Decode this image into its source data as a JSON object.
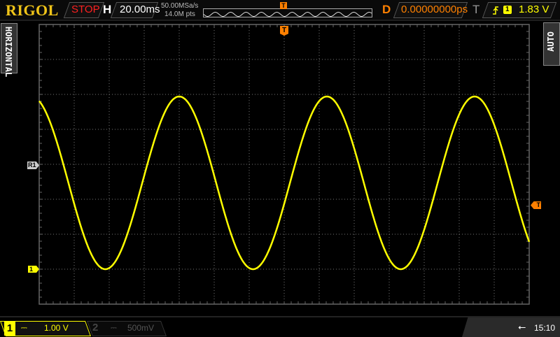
{
  "header": {
    "logo": "RIGOL",
    "run_state": "STOP",
    "horizontal_label": "H",
    "timebase": "20.00ms",
    "sample_rate": "50.00MSa/s",
    "memory_depth": "14.0M pts",
    "delay_label": "D",
    "delay_value": "0.00000000ps",
    "trigger_label": "T",
    "trigger_slope_icon": "rising-edge-icon",
    "trigger_source": "1",
    "trigger_level": "1.83 V"
  },
  "side_tabs": {
    "left": "HORIZONTAL",
    "right": "AUTO"
  },
  "markers": {
    "trigger_top": "T",
    "trigger_level": "T",
    "reference": "R1",
    "channel1_ground": "1"
  },
  "footer": {
    "ch1": {
      "number": "1",
      "coupling_icon": "dc-coupling-icon",
      "scale": "1.00 V"
    },
    "ch2": {
      "number": "2",
      "coupling_icon": "dc-coupling-icon",
      "scale": "500mV"
    },
    "usb_icon": "usb-icon",
    "clock": "15:10"
  },
  "colors": {
    "ch1": "#ffff00",
    "trigger": "#ff8000",
    "stop": "#ff0000",
    "grid": "#777777",
    "logo": "#f0c419"
  },
  "chart_data": {
    "type": "line",
    "x_unit": "ms",
    "y_unit": "V",
    "xlim": [
      -140,
      140
    ],
    "ylim": [
      -1,
      7
    ],
    "grid": true,
    "x_divisions": 14,
    "y_divisions": 8,
    "series": [
      {
        "channel": "1",
        "waveform": "sine",
        "amplitude_v": 2.47,
        "offset_v": 2.47,
        "period_ms": 84.4,
        "peak_times_ms": [
          -60,
          24.4,
          108.8
        ]
      }
    ]
  }
}
